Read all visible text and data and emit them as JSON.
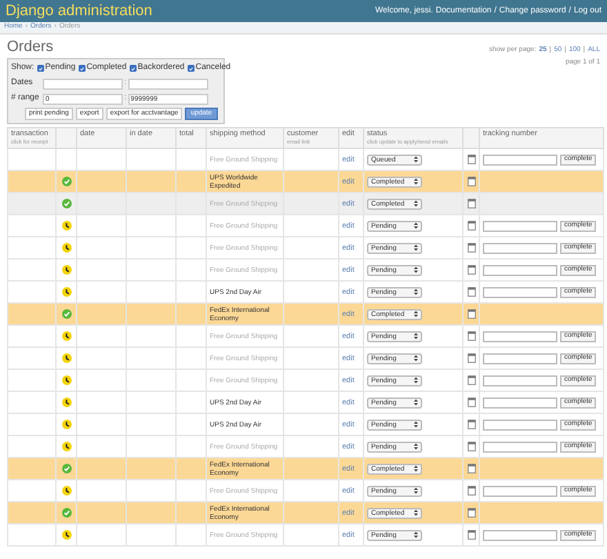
{
  "header": {
    "title": "Django administration",
    "welcome": "Welcome, jessi.",
    "links": [
      "Documentation",
      "Change password",
      "Log out"
    ],
    "separator": "/"
  },
  "breadcrumbs": {
    "items": [
      "Home",
      "Orders",
      "Orders"
    ],
    "separator": "›"
  },
  "page_title": "Orders",
  "pagination": {
    "label": "show per page:",
    "options": [
      {
        "label": "25",
        "selected": true
      },
      {
        "label": "50",
        "selected": false
      },
      {
        "label": "100",
        "selected": false
      },
      {
        "label": "ALL",
        "selected": false
      }
    ],
    "separator": "|",
    "page": "page 1 of 1"
  },
  "filters": {
    "show_label": "Show:",
    "statuses": [
      {
        "label": "Pending",
        "checked": true
      },
      {
        "label": "Completed",
        "checked": true
      },
      {
        "label": "Backordered",
        "checked": true
      },
      {
        "label": "Canceled",
        "checked": true
      }
    ],
    "dates": {
      "label": "Dates",
      "separator": ":"
    },
    "range": {
      "label": "# range",
      "from": "0",
      "to": "9999999",
      "separator": ":"
    },
    "buttons": [
      {
        "label": "print pending",
        "primary": false
      },
      {
        "label": "export",
        "primary": false
      },
      {
        "label": "export for acctvantage",
        "primary": false
      },
      {
        "label": "update",
        "primary": true
      }
    ]
  },
  "table": {
    "columns": [
      {
        "label": "transaction",
        "hint": "click for receipt"
      },
      {},
      {
        "label": "date"
      },
      {
        "label": "in date"
      },
      {
        "label": "total"
      },
      {
        "label": "shipping method"
      },
      {
        "label": "customer",
        "hint": "email link"
      },
      {
        "label": "edit"
      },
      {
        "label": "status",
        "hint": "click update to apply/send emails"
      },
      {},
      {
        "label": "tracking number"
      }
    ],
    "rows": [
      {
        "kind": "plain",
        "shipping": "Free Ground Shipping",
        "shipping_dimmed": true,
        "edit": "edit",
        "status": "Queued",
        "complete": "complete"
      },
      {
        "kind": "rush",
        "completed": true,
        "shipping": "UPS Worldwide Expedited",
        "shipping_dimmed": false,
        "edit": "edit",
        "status": "Completed"
      },
      {
        "kind": "hover",
        "completed": true,
        "shipping": "Free Ground Shipping",
        "shipping_dimmed": true,
        "edit": "edit",
        "status": "Completed"
      },
      {
        "kind": "plain",
        "completed": false,
        "shipping": "Free Ground Shipping",
        "shipping_dimmed": true,
        "edit": "edit",
        "status": "Pending",
        "complete": "complete"
      },
      {
        "kind": "plain",
        "completed": false,
        "shipping": "Free Ground Shipping",
        "shipping_dimmed": true,
        "edit": "edit",
        "status": "Pending",
        "complete": "complete"
      },
      {
        "kind": "plain",
        "completed": false,
        "shipping": "Free Ground Shipping",
        "shipping_dimmed": true,
        "edit": "edit",
        "status": "Pending",
        "complete": "complete"
      },
      {
        "kind": "plain",
        "completed": false,
        "shipping": "UPS 2nd Day Air",
        "shipping_dimmed": false,
        "edit": "edit",
        "status": "Pending",
        "complete": "complete"
      },
      {
        "kind": "rush",
        "completed": true,
        "shipping": "FedEx International Economy",
        "shipping_dimmed": false,
        "edit": "edit",
        "status": "Completed"
      },
      {
        "kind": "plain",
        "completed": false,
        "shipping": "Free Ground Shipping",
        "shipping_dimmed": true,
        "edit": "edit",
        "status": "Pending",
        "complete": "complete"
      },
      {
        "kind": "plain",
        "completed": false,
        "shipping": "Free Ground Shipping",
        "shipping_dimmed": true,
        "edit": "edit",
        "status": "Pending",
        "complete": "complete"
      },
      {
        "kind": "plain",
        "completed": false,
        "shipping": "Free Ground Shipping",
        "shipping_dimmed": true,
        "edit": "edit",
        "status": "Pending",
        "complete": "complete"
      },
      {
        "kind": "plain",
        "completed": false,
        "shipping": "UPS 2nd Day Air",
        "shipping_dimmed": false,
        "edit": "edit",
        "status": "Pending",
        "complete": "complete"
      },
      {
        "kind": "plain",
        "completed": false,
        "shipping": "UPS 2nd Day Air",
        "shipping_dimmed": false,
        "edit": "edit",
        "status": "Pending",
        "complete": "complete"
      },
      {
        "kind": "plain",
        "completed": false,
        "shipping": "Free Ground Shipping",
        "shipping_dimmed": true,
        "edit": "edit",
        "status": "Pending",
        "complete": "complete"
      },
      {
        "kind": "rush",
        "completed": true,
        "shipping": "FedEx International Economy",
        "shipping_dimmed": false,
        "edit": "edit",
        "status": "Completed"
      },
      {
        "kind": "plain",
        "completed": false,
        "shipping": "Free Ground Shipping",
        "shipping_dimmed": true,
        "edit": "edit",
        "status": "Pending",
        "complete": "complete"
      },
      {
        "kind": "rush",
        "completed": true,
        "shipping": "FedEx International Economy",
        "shipping_dimmed": false,
        "edit": "edit",
        "status": "Completed"
      },
      {
        "kind": "plain",
        "completed": false,
        "shipping": "Free Ground Shipping",
        "shipping_dimmed": true,
        "edit": "edit",
        "status": "Pending",
        "complete": "complete"
      }
    ]
  }
}
